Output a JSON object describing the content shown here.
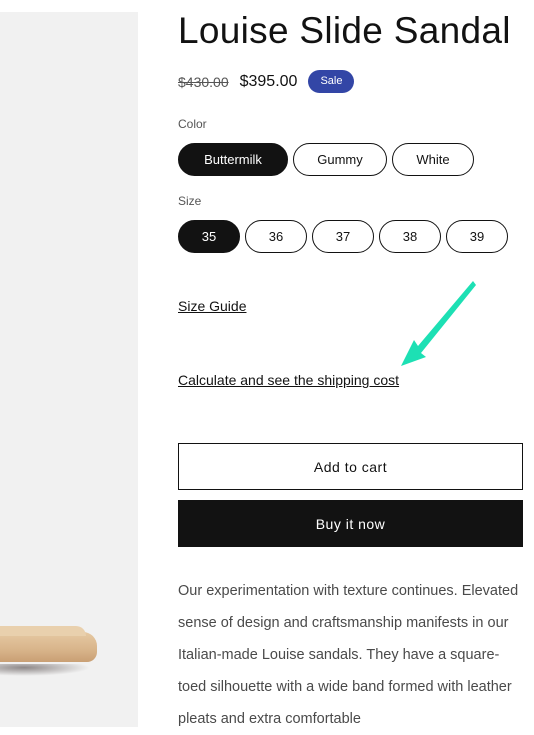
{
  "product": {
    "title": "Louise Slide Sandal",
    "compare_price": "$430.00",
    "price": "$395.00",
    "badge": "Sale"
  },
  "options": {
    "color": {
      "label": "Color",
      "values": [
        "Buttermilk",
        "Gummy",
        "White"
      ],
      "selected": "Buttermilk"
    },
    "size": {
      "label": "Size",
      "values": [
        "35",
        "36",
        "37",
        "38",
        "39"
      ],
      "selected": "35"
    }
  },
  "links": {
    "size_guide": "Size Guide",
    "shipping": "Calculate and see the shipping cost"
  },
  "buttons": {
    "add_to_cart": "Add to cart",
    "buy_now": "Buy it now"
  },
  "description": "Our experimentation with texture continues. Elevated sense of design and craftsmanship manifests in our Italian-made Louise sandals. They have a square-toed silhouette with a wide band formed with leather pleats and extra comfortable",
  "colors": {
    "badge": "#3346a6",
    "accent_arrow": "#1de0b4",
    "primary": "#121212"
  }
}
